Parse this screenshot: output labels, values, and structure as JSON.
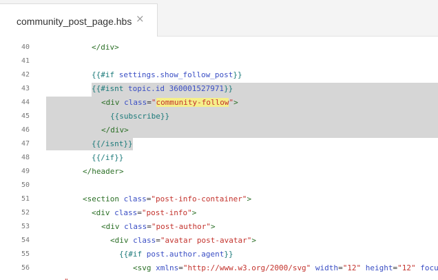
{
  "tab": {
    "filename": "community_post_page.hbs",
    "close_glyph": "×"
  },
  "colors": {
    "selection": "#d6d6d6",
    "tag": "#2a6e25",
    "handlebars": "#1c7a7a",
    "attribute": "#3a4ec4",
    "string": "#c3322c",
    "word_highlight": "#f5ef8a"
  },
  "lines": [
    {
      "num": "40",
      "parts": [
        {
          "t": "</div>",
          "c": "tag"
        }
      ]
    },
    {
      "num": "41",
      "parts": []
    },
    {
      "num": "42",
      "parts": [
        {
          "t": "{{#if ",
          "c": "hbs"
        },
        {
          "t": "settings.show_follow_post",
          "c": "attr"
        },
        {
          "t": "}}",
          "c": "hbs"
        }
      ]
    },
    {
      "num": "43",
      "parts": [
        {
          "t": "{{#isnt ",
          "c": "hbs"
        },
        {
          "t": "topic.id 360001527971",
          "c": "attr"
        },
        {
          "t": "}}",
          "c": "hbs"
        }
      ]
    },
    {
      "num": "44",
      "parts": [
        {
          "t": "<div ",
          "c": "tag"
        },
        {
          "t": "class",
          "c": "attr"
        },
        {
          "t": "=",
          "c": "plain"
        },
        {
          "t": "\"",
          "c": "str"
        },
        {
          "t": "community-follow",
          "c": "str",
          "hl": true
        },
        {
          "t": "\"",
          "c": "str"
        },
        {
          "t": ">",
          "c": "tag"
        }
      ]
    },
    {
      "num": "45",
      "parts": [
        {
          "t": "{{subscribe}}",
          "c": "hbs"
        }
      ]
    },
    {
      "num": "46",
      "parts": [
        {
          "t": "</div>",
          "c": "tag"
        }
      ]
    },
    {
      "num": "47",
      "parts": [
        {
          "t": "{{/isnt}}",
          "c": "hbs"
        }
      ]
    },
    {
      "num": "48",
      "parts": [
        {
          "t": "{{/if}}",
          "c": "hbs"
        }
      ]
    },
    {
      "num": "49",
      "parts": [
        {
          "t": "</header>",
          "c": "tag"
        }
      ]
    },
    {
      "num": "50",
      "parts": []
    },
    {
      "num": "51",
      "parts": [
        {
          "t": "<section ",
          "c": "tag"
        },
        {
          "t": "class",
          "c": "attr"
        },
        {
          "t": "=",
          "c": "plain"
        },
        {
          "t": "\"post-info-container\"",
          "c": "str"
        },
        {
          "t": ">",
          "c": "tag"
        }
      ]
    },
    {
      "num": "52",
      "parts": [
        {
          "t": "<div ",
          "c": "tag"
        },
        {
          "t": "class",
          "c": "attr"
        },
        {
          "t": "=",
          "c": "plain"
        },
        {
          "t": "\"post-info\"",
          "c": "str"
        },
        {
          "t": ">",
          "c": "tag"
        }
      ]
    },
    {
      "num": "53",
      "parts": [
        {
          "t": "<div ",
          "c": "tag"
        },
        {
          "t": "class",
          "c": "attr"
        },
        {
          "t": "=",
          "c": "plain"
        },
        {
          "t": "\"post-author\"",
          "c": "str"
        },
        {
          "t": ">",
          "c": "tag"
        }
      ]
    },
    {
      "num": "54",
      "parts": [
        {
          "t": "<div ",
          "c": "tag"
        },
        {
          "t": "class",
          "c": "attr"
        },
        {
          "t": "=",
          "c": "plain"
        },
        {
          "t": "\"avatar post-avatar\"",
          "c": "str"
        },
        {
          "t": ">",
          "c": "tag"
        }
      ]
    },
    {
      "num": "55",
      "parts": [
        {
          "t": "{{#if ",
          "c": "hbs"
        },
        {
          "t": "post.author.agent",
          "c": "attr"
        },
        {
          "t": "}}",
          "c": "hbs"
        }
      ]
    },
    {
      "num": "56",
      "parts": [
        {
          "t": "<svg ",
          "c": "tag"
        },
        {
          "t": "xmlns",
          "c": "attr"
        },
        {
          "t": "=",
          "c": "plain"
        },
        {
          "t": "\"http://www.w3.org/2000/svg\"",
          "c": "str"
        },
        {
          "t": " width",
          "c": "attr"
        },
        {
          "t": "=",
          "c": "plain"
        },
        {
          "t": "\"12\"",
          "c": "str"
        },
        {
          "t": " height",
          "c": "attr"
        },
        {
          "t": "=",
          "c": "plain"
        },
        {
          "t": "\"12\"",
          "c": "str"
        },
        {
          "t": " focu",
          "c": "attr"
        }
      ]
    },
    {
      "num": "",
      "parts": [
        {
          "t": "\"",
          "c": "str"
        }
      ]
    }
  ]
}
